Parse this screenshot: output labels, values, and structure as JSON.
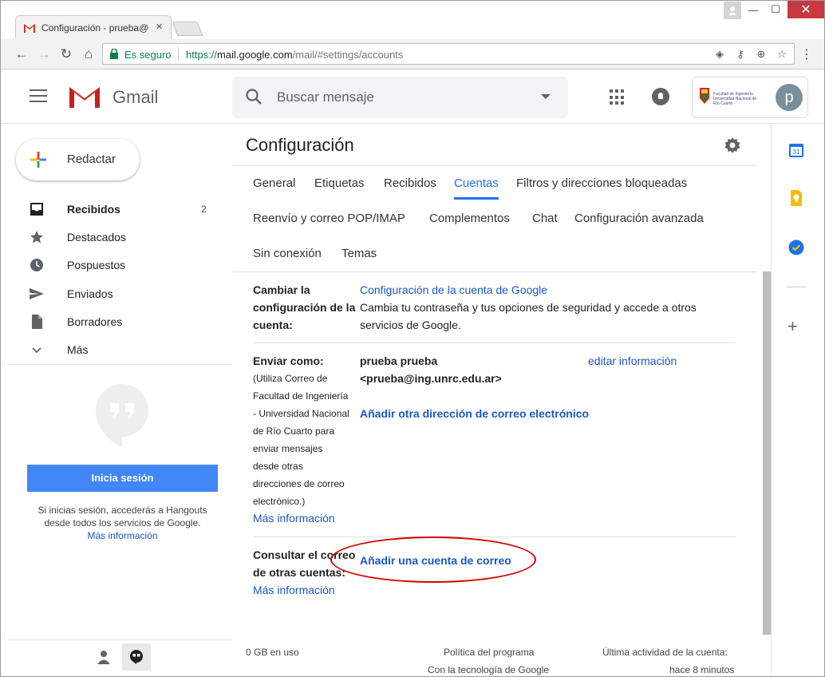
{
  "browser": {
    "tab_title": "Configuración - prueba@",
    "secure_label": "Es seguro",
    "url_proto": "https://",
    "url_host": "mail.google.com",
    "url_path": "/mail/#settings/accounts"
  },
  "header": {
    "product_name": "Gmail",
    "search_placeholder": "Buscar mensaje",
    "avatar_initial": "p",
    "org_name": "Facultad de Ingeniería Universidad Nacional de Río Cuarto"
  },
  "compose": {
    "label": "Redactar"
  },
  "nav": {
    "items": [
      {
        "label": "Recibidos",
        "count": "2",
        "icon": "inbox-icon"
      },
      {
        "label": "Destacados",
        "count": "",
        "icon": "star-icon"
      },
      {
        "label": "Pospuestos",
        "count": "",
        "icon": "clock-icon"
      },
      {
        "label": "Enviados",
        "count": "",
        "icon": "send-icon"
      },
      {
        "label": "Borradores",
        "count": "",
        "icon": "draft-icon"
      },
      {
        "label": "Más",
        "count": "",
        "icon": "chevron-down-icon"
      }
    ]
  },
  "hangouts": {
    "signin_label": "Inicia sesión",
    "hint": "Si inicias sesión, accederás a Hangouts desde todos los servicios de Google.",
    "more_link": "Más información"
  },
  "settings": {
    "title": "Configuración",
    "tabs": [
      {
        "label": "General"
      },
      {
        "label": "Etiquetas"
      },
      {
        "label": "Recibidos"
      },
      {
        "label": "Cuentas"
      },
      {
        "label": "Filtros y direcciones bloqueadas"
      },
      {
        "label": "Reenvío y correo POP/IMAP"
      },
      {
        "label": "Complementos"
      },
      {
        "label": "Chat"
      },
      {
        "label": "Configuración avanzada"
      },
      {
        "label": "Sin conexión"
      },
      {
        "label": "Temas"
      }
    ],
    "active_tab": "Cuentas",
    "account_settings": {
      "label_line1": "Cambiar la",
      "label_line2": "configuración de la",
      "label_line3": "cuenta:",
      "link": "Configuración de la cuenta de Google",
      "desc_line1": "Cambia tu contraseña y tus opciones de seguridad y accede a otros",
      "desc_line2": "servicios de Google."
    },
    "send_as": {
      "label": "Enviar como:",
      "note_lines": [
        "(Utiliza Correo de",
        "Facultad de Ingeniería",
        "- Universidad Nacional",
        "de Río Cuarto para",
        "enviar mensajes",
        "desde otras",
        "direcciones de correo",
        "electrónico.)"
      ],
      "more_link": "Más información",
      "name": "prueba prueba",
      "address": "<prueba@ing.unrc.edu.ar>",
      "edit_link": "editar información",
      "add_link": "Añadir otra dirección de correo electrónico"
    },
    "check_mail": {
      "label_line1": "Consultar el correo",
      "label_line2": "de otras cuentas:",
      "more_link": "Más información",
      "add_link": "Añadir una cuenta de correo"
    },
    "footer": {
      "storage": "0 GB en uso",
      "policy": "Política del programa",
      "powered": "Con la tecnología de Google",
      "last_activity_line1": "Última actividad de la cuenta:",
      "last_activity_line2": "hace 8 minutos"
    }
  },
  "side_panel": {
    "calendar_day": "31"
  },
  "colors": {
    "accent_blue": "#1a73e8",
    "link_blue": "#1a58c7",
    "signin_blue": "#4285f4",
    "annotation_red": "#d40000"
  }
}
